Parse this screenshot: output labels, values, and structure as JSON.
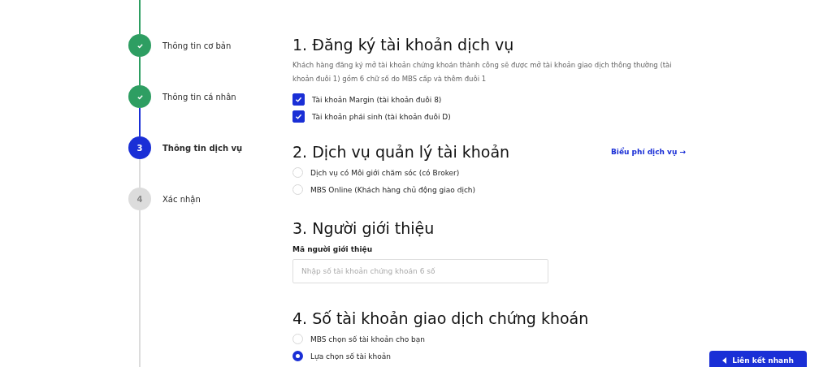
{
  "steps": [
    {
      "label": "Thông tin cơ bản",
      "completed": true,
      "selected": false
    },
    {
      "label": "Thông tin cá nhân",
      "completed": true,
      "selected": false
    },
    {
      "number": "3",
      "label": "Thông tin dịch vụ",
      "completed": false,
      "selected": true
    },
    {
      "number": "4",
      "label": "Xác nhận",
      "completed": false,
      "selected": false
    }
  ],
  "sections": [
    {
      "title": "1. Đăng ký tài khoản dịch vụ",
      "description": "Khách hàng đăng ký mở tài khoản chứng khoán thành công sẽ được mở tài khoản giao dịch thông thường (tài khoản đuôi 1) gồm 6 chữ số do MBS cấp và thêm đuôi 1",
      "checkboxes": [
        {
          "label": "Tài khoản Margin (tài khoản đuôi 8)",
          "checked": true
        },
        {
          "label": "Tài khoản phái sinh (tài khoản đuôi D)",
          "checked": true
        }
      ]
    },
    {
      "title": "2. Dịch vụ quản lý tài khoản",
      "link": "Biểu phí dịch vụ →",
      "radios": [
        {
          "label": "Dịch vụ có Môi giới chăm sóc (có Broker)",
          "selected": false
        },
        {
          "label": "MBS Online (Khách hàng chủ động giao dịch)",
          "selected": false
        }
      ]
    },
    {
      "title": "3. Người giới thiệu",
      "field": {
        "label": "Mã người giới thiệu",
        "placeholder": "Nhập số tài khoản chứng khoán 6 số"
      }
    },
    {
      "title": "4. Số tài khoản giao dịch chứng khoán",
      "radios": [
        {
          "label": "MBS chọn số tài khoản cho bạn",
          "selected": false
        },
        {
          "label": "Lựa chọn số tài khoản",
          "selected": true
        }
      ]
    }
  ],
  "quick_link_button": "Liên kết nhanh"
}
